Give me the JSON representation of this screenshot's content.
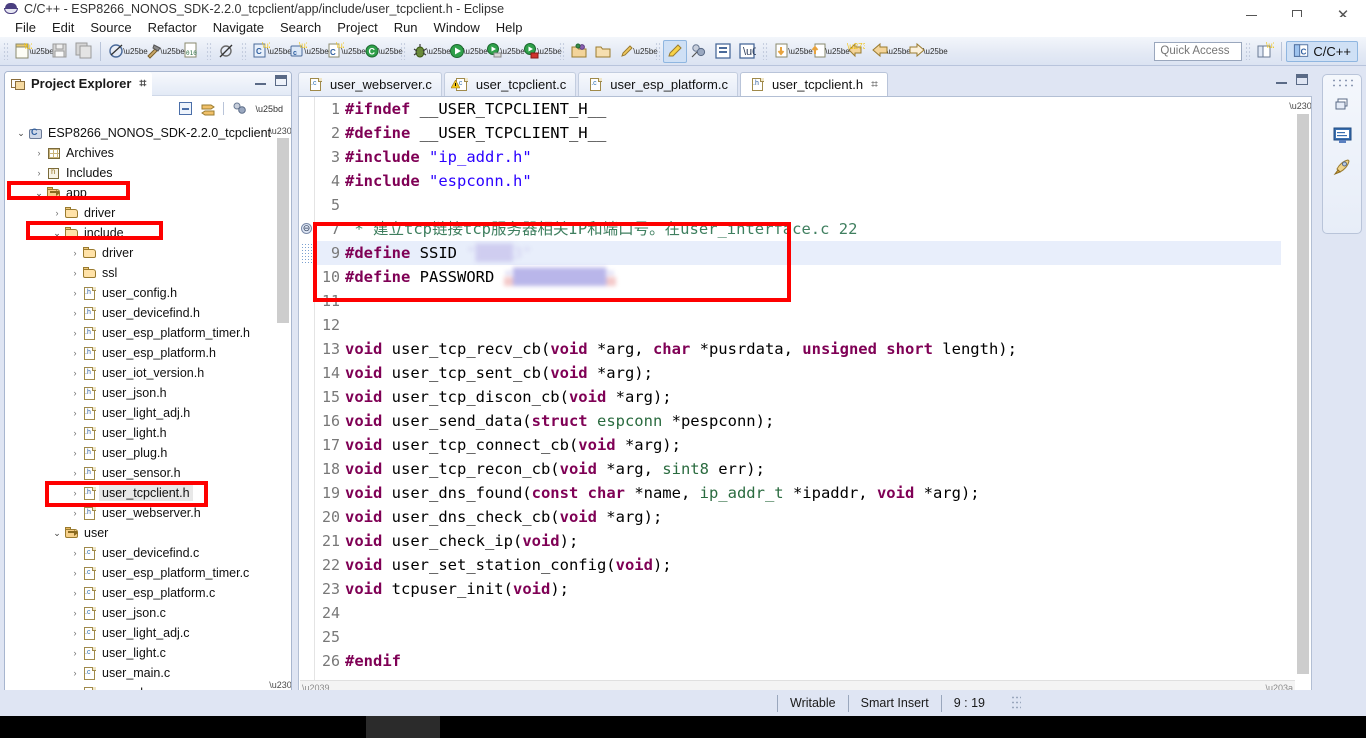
{
  "window": {
    "title": "C/C++ - ESP8266_NONOS_SDK-2.2.0_tcpclient/app/include/user_tcpclient.h - Eclipse",
    "app_icon": "eclipse-icon",
    "minimize": "minimize-button",
    "maximize": "maximize-button",
    "close": "close-button",
    "close_glyph": "✕"
  },
  "menu": {
    "items": [
      "File",
      "Edit",
      "Source",
      "Refactor",
      "Navigate",
      "Search",
      "Project",
      "Run",
      "Window",
      "Help"
    ]
  },
  "toolbar": {
    "quick_access_placeholder": "Quick Access",
    "quick_access_value": "",
    "perspective_label": "C/C++",
    "groups": [
      {
        "icons": [
          "new-file-icon",
          "save-icon",
          "save-all-icon"
        ]
      },
      {
        "icons": [
          "build-all-icon",
          "build-hammer-icon",
          "binary-010-icon"
        ]
      },
      {
        "icons": [
          "skip-breakpoints-icon"
        ]
      },
      {
        "icons": [
          "new-c-project-icon",
          "new-c-folder-icon",
          "new-c-source-file-icon",
          "build-configurations-icon"
        ]
      },
      {
        "icons": [
          "debug-bug-icon",
          "run-icon",
          "run-last-tool-icon",
          "external-tools-icon"
        ]
      },
      {
        "icons": [
          "open-type-icon",
          "open-resource-icon",
          "toggle-mark-occurrences-icon",
          "pin-editor-icon"
        ]
      },
      {
        "icons": [
          "toggle-block-selection-icon",
          "show-whitespace-icon",
          "next-annotation-icon",
          "previous-annotation-icon",
          "last-edit-location-icon",
          "back-icon",
          "forward-icon"
        ]
      }
    ]
  },
  "project_explorer": {
    "tab_label": "Project Explorer",
    "tab_icon": "project-explorer-icon",
    "close_glyph": "⌗",
    "tools": [
      "collapse-all-icon",
      "link-with-editor-icon",
      "view-menu-icon"
    ],
    "tree": [
      {
        "depth": 0,
        "label": "ESP8266_NONOS_SDK-2.2.0_tcpclient",
        "icon": "c-project-icon",
        "twisty": "open",
        "selected": false,
        "highlight": false
      },
      {
        "depth": 1,
        "label": "Archives",
        "icon": "archives-icon",
        "twisty": "closed",
        "selected": false,
        "highlight": false
      },
      {
        "depth": 1,
        "label": "Includes",
        "icon": "includes-icon",
        "twisty": "closed",
        "selected": false,
        "highlight": false
      },
      {
        "depth": 1,
        "label": "app",
        "icon": "source-folder-icon",
        "twisty": "open",
        "selected": false,
        "highlight": true
      },
      {
        "depth": 2,
        "label": "driver",
        "icon": "folder-icon",
        "twisty": "closed",
        "selected": false,
        "highlight": false
      },
      {
        "depth": 2,
        "label": "include",
        "icon": "folder-icon",
        "twisty": "open",
        "selected": false,
        "highlight": true
      },
      {
        "depth": 3,
        "label": "driver",
        "icon": "folder-icon",
        "twisty": "closed",
        "selected": false,
        "highlight": false
      },
      {
        "depth": 3,
        "label": "ssl",
        "icon": "folder-icon",
        "twisty": "closed",
        "selected": false,
        "highlight": false
      },
      {
        "depth": 3,
        "label": "user_config.h",
        "icon": "h-file-icon",
        "twisty": "closed",
        "selected": false,
        "highlight": false
      },
      {
        "depth": 3,
        "label": "user_devicefind.h",
        "icon": "h-file-icon",
        "twisty": "closed",
        "selected": false,
        "highlight": false
      },
      {
        "depth": 3,
        "label": "user_esp_platform_timer.h",
        "icon": "h-file-icon",
        "twisty": "closed",
        "selected": false,
        "highlight": false
      },
      {
        "depth": 3,
        "label": "user_esp_platform.h",
        "icon": "h-file-icon",
        "twisty": "closed",
        "selected": false,
        "highlight": false
      },
      {
        "depth": 3,
        "label": "user_iot_version.h",
        "icon": "h-file-icon",
        "twisty": "closed",
        "selected": false,
        "highlight": false
      },
      {
        "depth": 3,
        "label": "user_json.h",
        "icon": "h-file-icon",
        "twisty": "closed",
        "selected": false,
        "highlight": false
      },
      {
        "depth": 3,
        "label": "user_light_adj.h",
        "icon": "h-file-icon",
        "twisty": "closed",
        "selected": false,
        "highlight": false
      },
      {
        "depth": 3,
        "label": "user_light.h",
        "icon": "h-file-icon",
        "twisty": "closed",
        "selected": false,
        "highlight": false
      },
      {
        "depth": 3,
        "label": "user_plug.h",
        "icon": "h-file-icon",
        "twisty": "closed",
        "selected": false,
        "highlight": false
      },
      {
        "depth": 3,
        "label": "user_sensor.h",
        "icon": "h-file-icon",
        "twisty": "closed",
        "selected": false,
        "highlight": false
      },
      {
        "depth": 3,
        "label": "user_tcpclient.h",
        "icon": "h-file-icon",
        "twisty": "closed",
        "selected": true,
        "highlight": true
      },
      {
        "depth": 3,
        "label": "user_webserver.h",
        "icon": "h-file-icon",
        "twisty": "closed",
        "selected": false,
        "highlight": false
      },
      {
        "depth": 2,
        "label": "user",
        "icon": "source-folder-icon",
        "twisty": "open",
        "selected": false,
        "highlight": false
      },
      {
        "depth": 3,
        "label": "user_devicefind.c",
        "icon": "c-file-icon",
        "twisty": "closed",
        "selected": false,
        "highlight": false
      },
      {
        "depth": 3,
        "label": "user_esp_platform_timer.c",
        "icon": "c-file-icon",
        "twisty": "closed",
        "selected": false,
        "highlight": false
      },
      {
        "depth": 3,
        "label": "user_esp_platform.c",
        "icon": "c-file-icon",
        "twisty": "closed",
        "selected": false,
        "highlight": false
      },
      {
        "depth": 3,
        "label": "user_json.c",
        "icon": "c-file-icon",
        "twisty": "closed",
        "selected": false,
        "highlight": false
      },
      {
        "depth": 3,
        "label": "user_light_adj.c",
        "icon": "c-file-icon",
        "twisty": "closed",
        "selected": false,
        "highlight": false
      },
      {
        "depth": 3,
        "label": "user_light.c",
        "icon": "c-file-icon",
        "twisty": "closed",
        "selected": false,
        "highlight": false
      },
      {
        "depth": 3,
        "label": "user_main.c",
        "icon": "c-file-icon",
        "twisty": "closed",
        "selected": false,
        "highlight": false
      },
      {
        "depth": 3,
        "label": "user_plug.c",
        "icon": "c-file-icon",
        "twisty": "closed",
        "selected": false,
        "highlight": false
      }
    ]
  },
  "editor": {
    "tabs": [
      {
        "label": "user_webserver.c",
        "icon": "c-file-icon",
        "active": false,
        "closeable": false,
        "warning": false
      },
      {
        "label": "user_tcpclient.c",
        "icon": "c-file-warning-icon",
        "active": false,
        "closeable": false,
        "warning": true
      },
      {
        "label": "user_esp_platform.c",
        "icon": "c-file-icon",
        "active": false,
        "closeable": false,
        "warning": false
      },
      {
        "label": "user_tcpclient.h",
        "icon": "h-file-icon",
        "active": true,
        "closeable": true,
        "warning": false
      }
    ],
    "active_tab_close_glyph": "⌗",
    "minimize": "minimize-button",
    "maximize": "maximize-button",
    "lines": [
      {
        "n": "1",
        "tokens": [
          {
            "t": "#ifndef",
            "c": "pp"
          },
          {
            "t": " __USER_TCPCLIENT_H__",
            "c": "plain"
          }
        ]
      },
      {
        "n": "2",
        "tokens": [
          {
            "t": "#define",
            "c": "pp"
          },
          {
            "t": " __USER_TCPCLIENT_H__",
            "c": "plain"
          }
        ]
      },
      {
        "n": "3",
        "tokens": [
          {
            "t": "#include",
            "c": "pp"
          },
          {
            "t": " ",
            "c": "plain"
          },
          {
            "t": "\"ip_addr.h\"",
            "c": "str"
          }
        ]
      },
      {
        "n": "4",
        "tokens": [
          {
            "t": "#include",
            "c": "pp"
          },
          {
            "t": " ",
            "c": "plain"
          },
          {
            "t": "\"espconn.h\"",
            "c": "str"
          }
        ]
      },
      {
        "n": "5",
        "tokens": []
      },
      {
        "n": "7",
        "tokens": [
          {
            "t": " * 建立tcp链接tcp服务器相关IP和端口号。在user_interface.c 22",
            "c": "cmt"
          }
        ],
        "fold": true
      },
      {
        "n": "9",
        "tokens": [
          {
            "t": "#define",
            "c": "pp"
          },
          {
            "t": " SSID ",
            "c": "plain"
          },
          {
            "t": "\"████3\"",
            "c": "str"
          }
        ],
        "highlight": true,
        "redacted": "ssid"
      },
      {
        "n": "10",
        "tokens": [
          {
            "t": "#define",
            "c": "pp"
          },
          {
            "t": " PASSWORD ",
            "c": "plain"
          },
          {
            "t": "\"██████████\"",
            "c": "str"
          }
        ],
        "redacted": "password"
      },
      {
        "n": "11",
        "tokens": []
      },
      {
        "n": "12",
        "tokens": []
      },
      {
        "n": "13",
        "tokens": [
          {
            "t": "void",
            "c": "kw"
          },
          {
            "t": " user_tcp_recv_cb(",
            "c": "plain"
          },
          {
            "t": "void",
            "c": "kw"
          },
          {
            "t": " *arg, ",
            "c": "plain"
          },
          {
            "t": "char",
            "c": "kw"
          },
          {
            "t": " *pusrdata, ",
            "c": "plain"
          },
          {
            "t": "unsigned",
            "c": "kw"
          },
          {
            "t": " ",
            "c": "plain"
          },
          {
            "t": "short",
            "c": "kw"
          },
          {
            "t": " length);",
            "c": "plain"
          }
        ]
      },
      {
        "n": "14",
        "tokens": [
          {
            "t": "void",
            "c": "kw"
          },
          {
            "t": " user_tcp_sent_cb(",
            "c": "plain"
          },
          {
            "t": "void",
            "c": "kw"
          },
          {
            "t": " *arg);",
            "c": "plain"
          }
        ]
      },
      {
        "n": "15",
        "tokens": [
          {
            "t": "void",
            "c": "kw"
          },
          {
            "t": " user_tcp_discon_cb(",
            "c": "plain"
          },
          {
            "t": "void",
            "c": "kw"
          },
          {
            "t": " *arg);",
            "c": "plain"
          }
        ]
      },
      {
        "n": "16",
        "tokens": [
          {
            "t": "void",
            "c": "kw"
          },
          {
            "t": " user_send_data(",
            "c": "plain"
          },
          {
            "t": "struct",
            "c": "kw"
          },
          {
            "t": " ",
            "c": "plain"
          },
          {
            "t": "espconn",
            "c": "typ"
          },
          {
            "t": " *pespconn);",
            "c": "plain"
          }
        ]
      },
      {
        "n": "17",
        "tokens": [
          {
            "t": "void",
            "c": "kw"
          },
          {
            "t": " user_tcp_connect_cb(",
            "c": "plain"
          },
          {
            "t": "void",
            "c": "kw"
          },
          {
            "t": " *arg);",
            "c": "plain"
          }
        ]
      },
      {
        "n": "18",
        "tokens": [
          {
            "t": "void",
            "c": "kw"
          },
          {
            "t": " user_tcp_recon_cb(",
            "c": "plain"
          },
          {
            "t": "void",
            "c": "kw"
          },
          {
            "t": " *arg, ",
            "c": "plain"
          },
          {
            "t": "sint8",
            "c": "typ"
          },
          {
            "t": " err);",
            "c": "plain"
          }
        ]
      },
      {
        "n": "19",
        "tokens": [
          {
            "t": "void",
            "c": "kw"
          },
          {
            "t": " user_dns_found(",
            "c": "plain"
          },
          {
            "t": "const",
            "c": "kw"
          },
          {
            "t": " ",
            "c": "plain"
          },
          {
            "t": "char",
            "c": "kw"
          },
          {
            "t": " *name, ",
            "c": "plain"
          },
          {
            "t": "ip_addr_t",
            "c": "typ"
          },
          {
            "t": " *ipaddr, ",
            "c": "plain"
          },
          {
            "t": "void",
            "c": "kw"
          },
          {
            "t": " *arg);",
            "c": "plain"
          }
        ]
      },
      {
        "n": "20",
        "tokens": [
          {
            "t": "void",
            "c": "kw"
          },
          {
            "t": " user_dns_check_cb(",
            "c": "plain"
          },
          {
            "t": "void",
            "c": "kw"
          },
          {
            "t": " *arg);",
            "c": "plain"
          }
        ]
      },
      {
        "n": "21",
        "tokens": [
          {
            "t": "void",
            "c": "kw"
          },
          {
            "t": " user_check_ip(",
            "c": "plain"
          },
          {
            "t": "void",
            "c": "kw"
          },
          {
            "t": ");",
            "c": "plain"
          }
        ]
      },
      {
        "n": "22",
        "tokens": [
          {
            "t": "void",
            "c": "kw"
          },
          {
            "t": " user_set_station_config(",
            "c": "plain"
          },
          {
            "t": "void",
            "c": "kw"
          },
          {
            "t": ");",
            "c": "plain"
          }
        ]
      },
      {
        "n": "23",
        "tokens": [
          {
            "t": "void",
            "c": "kw"
          },
          {
            "t": " tcpuser_init(",
            "c": "plain"
          },
          {
            "t": "void",
            "c": "kw"
          },
          {
            "t": ");",
            "c": "plain"
          }
        ]
      },
      {
        "n": "24",
        "tokens": []
      },
      {
        "n": "25",
        "tokens": []
      },
      {
        "n": "26",
        "tokens": [
          {
            "t": "#endif",
            "c": "pp"
          }
        ]
      }
    ]
  },
  "right_toolbar": {
    "buttons": [
      "restore-view-icon",
      "console-view-icon",
      "launch-rocket-icon"
    ]
  },
  "status_bar": {
    "writable": "Writable",
    "insert_mode": "Smart Insert",
    "cursor_position": "9 : 19"
  },
  "annotations": {
    "color": "#fe0000",
    "boxes": [
      "app-tree-row",
      "include-tree-row",
      "user-tcpclient-h-tree-row",
      "ssid-password-code-block"
    ]
  }
}
